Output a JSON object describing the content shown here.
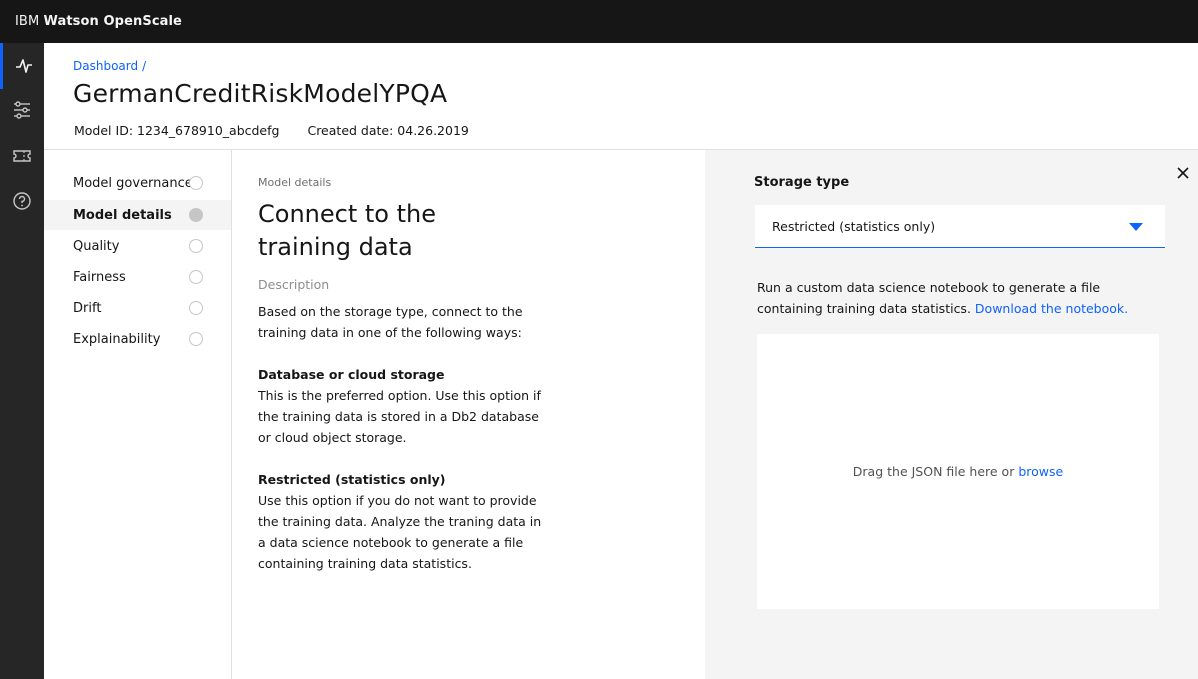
{
  "app": {
    "brand_prefix": "IBM ",
    "brand_name": "Watson OpenScale"
  },
  "rail": {
    "items": [
      {
        "icon": "activity-icon",
        "active": true
      },
      {
        "icon": "sliders-icon",
        "active": false
      },
      {
        "icon": "ticket-icon",
        "active": false
      },
      {
        "icon": "help-icon",
        "active": false
      }
    ]
  },
  "header": {
    "breadcrumb": "Dashboard",
    "breadcrumb_sep": "/",
    "title": "GermanCreditRiskModelYPQA",
    "model_id": "Model ID: 1234_678910_abcdefg",
    "created_date": "Created date: 04.26.2019"
  },
  "steps": [
    {
      "label": "Model governance",
      "active": false
    },
    {
      "label": "Model details",
      "active": true
    },
    {
      "label": "Quality",
      "active": false
    },
    {
      "label": "Fairness",
      "active": false
    },
    {
      "label": "Drift",
      "active": false
    },
    {
      "label": "Explainability",
      "active": false
    }
  ],
  "content": {
    "section_label": "Model details",
    "heading": "Connect to the training data",
    "description_label": "Description",
    "intro": "Based on the storage type, connect to the training data in one of the following ways:",
    "option1_title": "Database or cloud storage",
    "option1_text": "This is the preferred option. Use this option if the training data is stored in a Db2 database or cloud object storage.",
    "option2_title": "Restricted (statistics only)",
    "option2_text": "Use this option if you do not want to provide the training data. Analyze the traning data in a data science notebook to generate a file containing training data statistics."
  },
  "panel": {
    "storage_label": "Storage type",
    "storage_value": "Restricted (statistics only)",
    "instructions": "Run a custom data science notebook to generate a file containing training data statistics.",
    "notebook_link": "Download the notebook.",
    "drop_text": "Drag the JSON file here or",
    "browse_link": "browse"
  },
  "colors": {
    "accent": "#0f62fe",
    "topbar": "#161616",
    "rail": "#262626",
    "panel_bg": "#f4f4f4"
  }
}
